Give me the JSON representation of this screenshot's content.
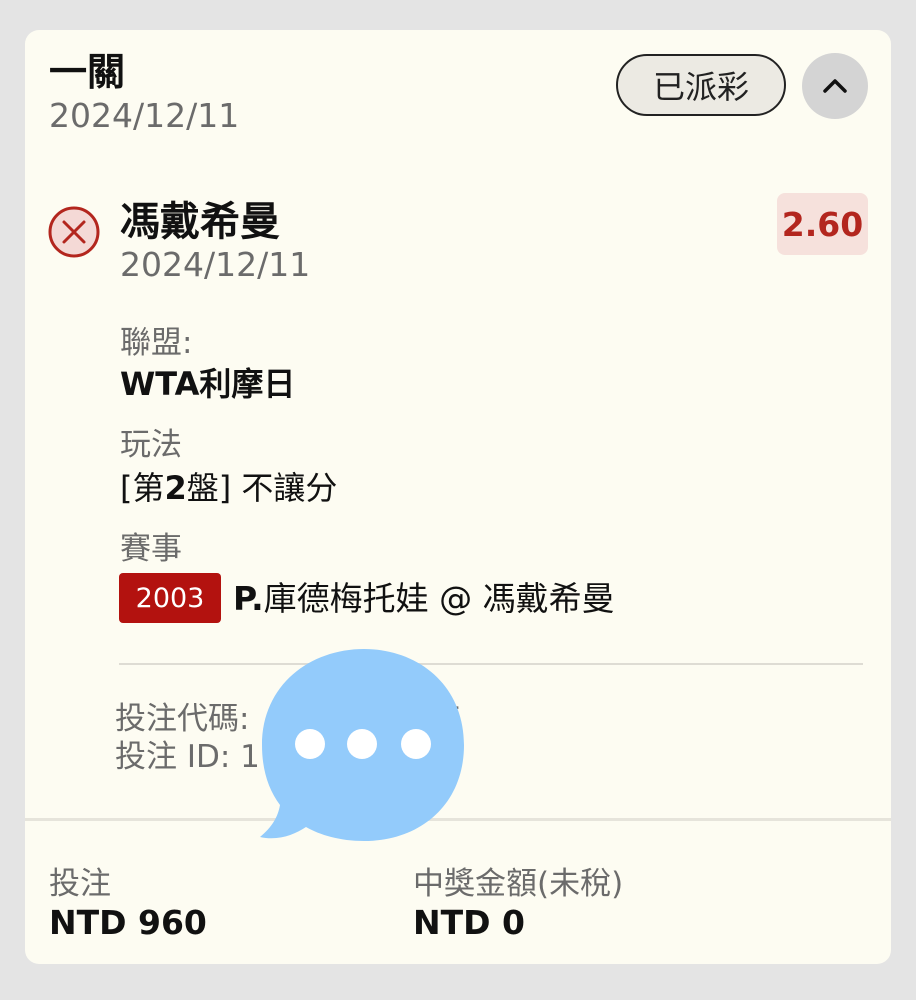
{
  "header": {
    "title": "一關",
    "date": "2024/12/11",
    "status_label": "已派彩",
    "collapse_icon": "chevron-up-icon"
  },
  "selection": {
    "result_icon": "lose-x-circle-icon",
    "name": "馮戴希曼",
    "date": "2024/12/11",
    "odds": "2.60",
    "league_label": "聯盟:",
    "league_value": "WTA利摩日",
    "market_label": "玩法",
    "market_prefix": "[第",
    "market_set": "2",
    "market_suffix": "盤] 不讓分",
    "event_label": "賽事",
    "event_code": "2003",
    "event_player_initial": "P.",
    "event_match": "庫德梅托娃 @ 馮戴希曼"
  },
  "bet_meta": {
    "code_label": "投注代碼:",
    "code_partial_end": "5",
    "id_label": "投注 ID: 1"
  },
  "footer": {
    "stake_label": "投注",
    "stake_value": "NTD 960",
    "payout_label": "中獎金額(未稅)",
    "payout_value": "NTD 0"
  },
  "overlay": {
    "icon": "chat-bubble-ellipsis-icon"
  },
  "colors": {
    "background": "#e4e4e4",
    "card": "#fdfcf2",
    "accent_red": "#b3261e",
    "odds_bg": "#f6e1dc",
    "event_code_bg": "#b3120f",
    "bubble": "#93cbfb"
  }
}
